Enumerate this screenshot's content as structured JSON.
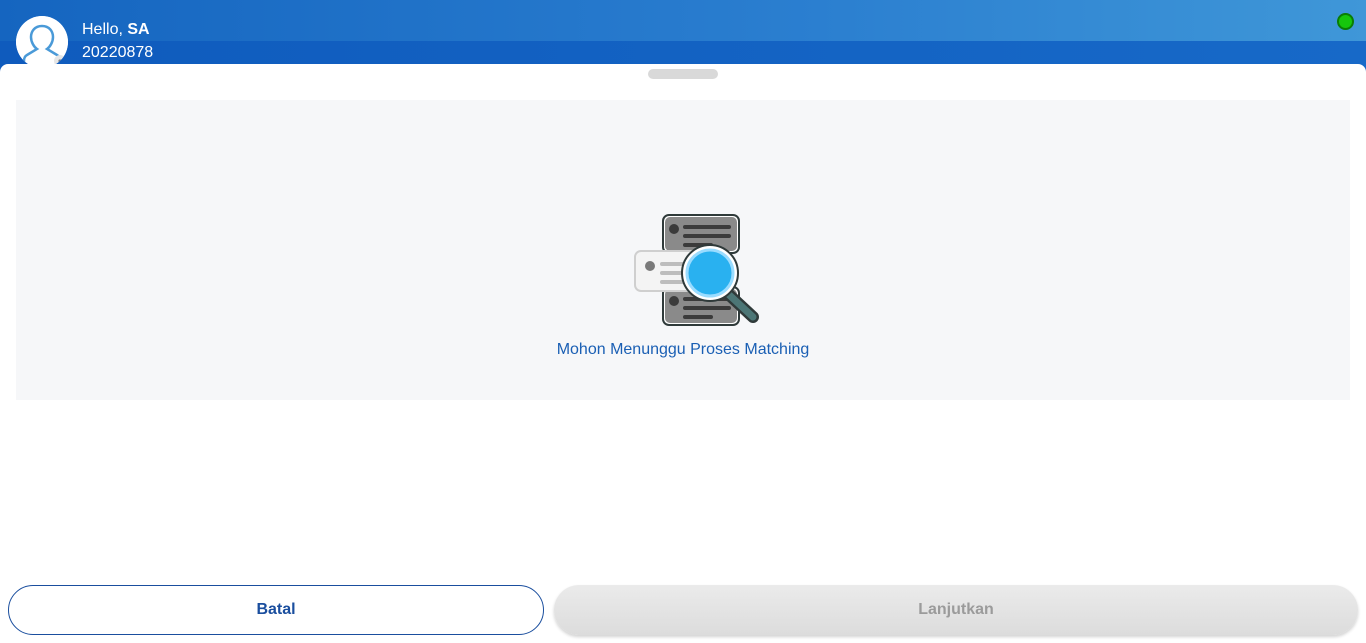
{
  "header": {
    "greeting_prefix": "Hello, ",
    "user_name": "SA",
    "user_id": "20220878",
    "status_color": "#16c60c"
  },
  "main": {
    "message": "Mohon Menunggu Proses Matching",
    "illustration_icon": "search-documents-icon"
  },
  "actions": {
    "cancel_label": "Batal",
    "next_label": "Lanjutkan"
  },
  "colors": {
    "brand_blue": "#1565c0",
    "button_border": "#1a4e9e",
    "message_text": "#1a5fb4"
  }
}
